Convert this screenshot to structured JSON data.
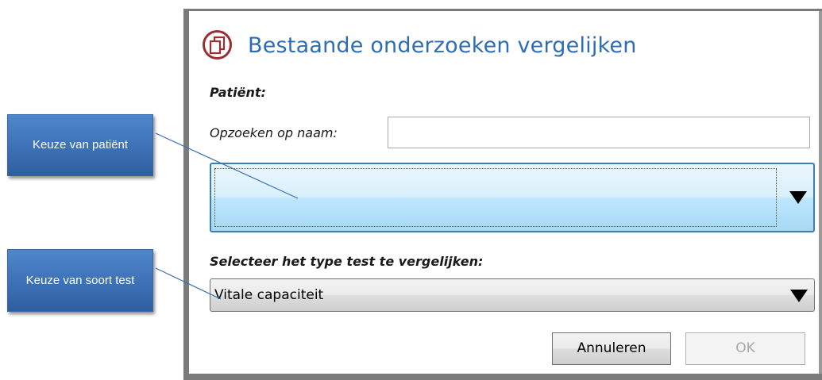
{
  "dialog": {
    "title": "Bestaande onderzoeken vergelijken",
    "icon": "compare-documents-icon",
    "patient_label": "Patiënt:",
    "search_label": "Opzoeken op naam:",
    "search_value": "",
    "patient_selected": "",
    "test_type_label": "Selecteer het type test te vergelijken:",
    "test_type_selected": "Vitale capaciteit",
    "cancel_label": "Annuleren",
    "ok_label": "OK"
  },
  "callouts": {
    "patient": "Keuze van patiënt",
    "test": "Keuze van soort test"
  },
  "colors": {
    "title": "#2f6db3",
    "icon_ring": "#9b2f2f",
    "callout": "#3b6fb4",
    "dropdown_highlight": "#bee6fd"
  }
}
